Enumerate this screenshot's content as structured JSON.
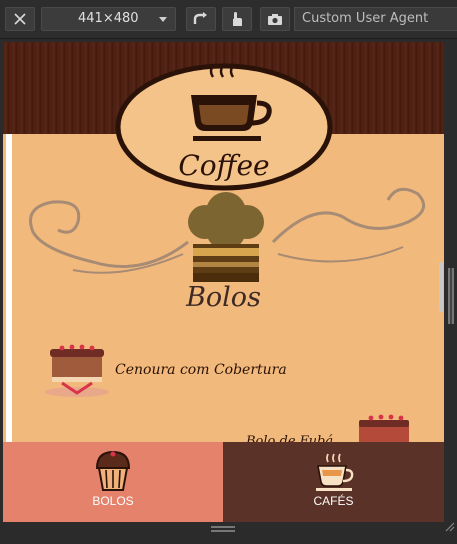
{
  "toolbar": {
    "close_icon": "close-icon",
    "dimensions_label": "441×480",
    "rotate_icon": "rotate-icon",
    "touch_icon": "touch-icon",
    "screenshot_icon": "camera-icon",
    "user_agent_value": "Custom User Agent"
  },
  "app": {
    "logo_text": "Coffee",
    "section_title": "Bolos",
    "items": [
      {
        "label": "Cenoura com Cobertura"
      },
      {
        "label": "Bolo de Fubá"
      }
    ]
  },
  "tabs": [
    {
      "label": "BOLOS",
      "icon": "muffin-icon",
      "color": "#e5826c"
    },
    {
      "label": "CAFÉS",
      "icon": "coffee-cup-icon",
      "color": "#5a3227"
    }
  ],
  "colors": {
    "page_background": "#f2b97c",
    "wood": "#4a1f12",
    "accent_brown": "#2a1208"
  }
}
